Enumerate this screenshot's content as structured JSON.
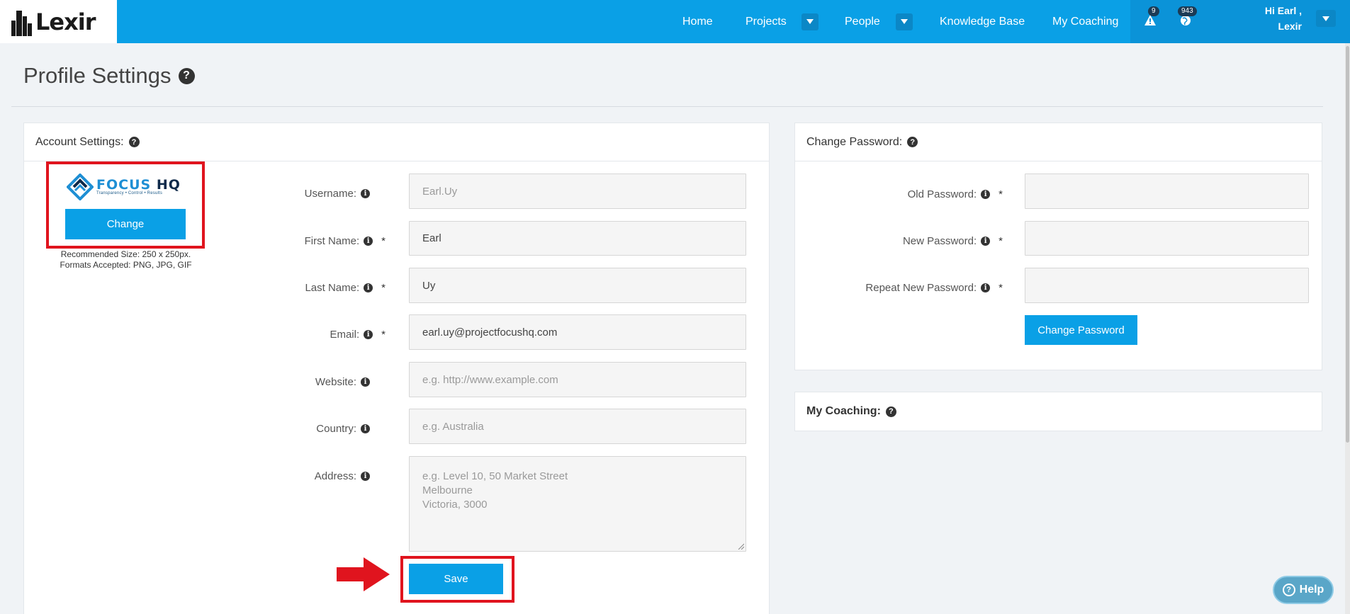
{
  "app": {
    "logo_text": "Lexir"
  },
  "nav": {
    "home": "Home",
    "projects": "Projects",
    "people": "People",
    "knowledge_base": "Knowledge Base",
    "my_coaching": "My Coaching",
    "alerts_count": "9",
    "updates_count": "943",
    "greeting_line1": "Hi Earl ,",
    "greeting_line2": "Lexir"
  },
  "page": {
    "title": "Profile Settings"
  },
  "account": {
    "heading": "Account Settings:",
    "avatar_logo_main": "FOCUS",
    "avatar_logo_suffix": "HQ",
    "avatar_logo_tagline": "Transparency • Control • Results",
    "change_button": "Change",
    "recommend_line1": "Recommended Size: 250 x 250px.",
    "recommend_line2": "Formats Accepted: PNG, JPG, GIF",
    "username_label": "Username:",
    "username_value": "Earl.Uy",
    "first_name_label": "First Name:",
    "first_name_value": "Earl",
    "last_name_label": "Last Name:",
    "last_name_value": "Uy",
    "email_label": "Email:",
    "email_value": "earl.uy@projectfocushq.com",
    "website_label": "Website:",
    "website_placeholder": "e.g. http://www.example.com",
    "country_label": "Country:",
    "country_placeholder": "e.g. Australia",
    "address_label": "Address:",
    "address_placeholder": "e.g. Level 10, 50 Market Street\nMelbourne\nVictoria, 3000",
    "save_button": "Save",
    "required_mark": "*"
  },
  "password": {
    "heading": "Change Password:",
    "old_label": "Old Password:",
    "new_label": "New Password:",
    "repeat_label": "Repeat New Password:",
    "change_button": "Change Password"
  },
  "coaching": {
    "heading": "My Coaching:"
  },
  "help_button": "Help",
  "colors": {
    "brand": "#0aa0e6",
    "annotation": "#e0141e"
  }
}
